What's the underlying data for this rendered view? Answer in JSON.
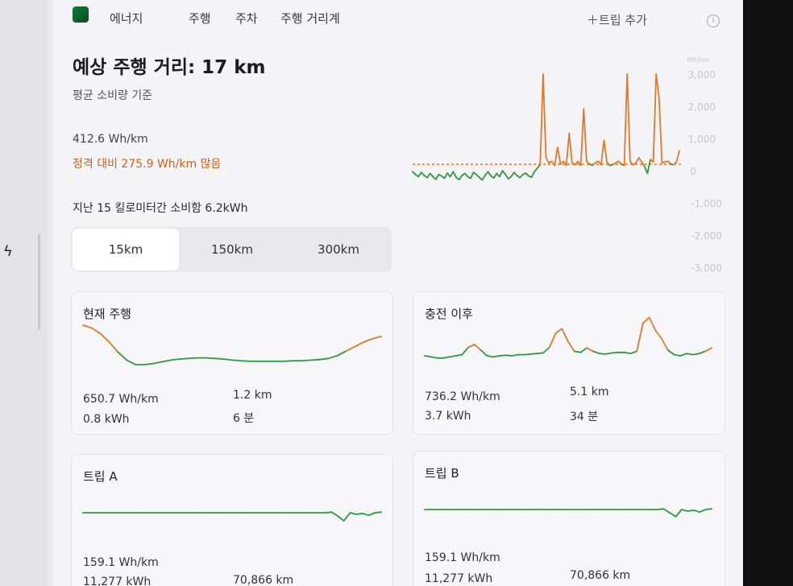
{
  "nav": {
    "tabs": [
      "에너지",
      "주행",
      "주차",
      "주행 거리계"
    ],
    "add_trip": "트립 추가",
    "add_icon": "plus-icon",
    "info_icon": "info-icon"
  },
  "summary": {
    "title": "예상 주행 거리: 17 km",
    "subtitle": "평균 소비량 기준",
    "avg_rate": "412.6 Wh/km",
    "vs_rated": "정격 대비 275.9 Wh/km 많음",
    "consumed": "지난 15 킬로미터간 소비함 6.2kWh"
  },
  "range_selector": {
    "options": [
      "15km",
      "150km",
      "300km"
    ],
    "selected": "15km"
  },
  "colors": {
    "above": "#e0782e",
    "below": "#2e9a3e",
    "warn_text": "#c9621a"
  },
  "chart_data": {
    "type": "line",
    "ylabel_unit": "Wh/km",
    "ylim": [
      -3000,
      3000
    ],
    "yticks": [
      "3,000",
      "2,000",
      "1,000",
      "0",
      "-1,000",
      "-2,000",
      "-3,000"
    ],
    "reference_line": 412.6,
    "series": [
      {
        "values": [
          200,
          120,
          60,
          180,
          90,
          30,
          150,
          60,
          -20,
          120,
          80,
          10,
          160,
          60,
          200,
          40,
          -30,
          90,
          150,
          60,
          10,
          180,
          120,
          40,
          -40,
          100,
          200,
          80,
          20,
          150,
          60,
          230,
          120,
          0,
          60,
          180,
          90,
          30,
          120,
          160,
          80,
          40,
          200,
          300,
          400,
          3000,
          600,
          450,
          500,
          380,
          900,
          420,
          500,
          380,
          1300,
          450,
          400,
          500,
          380,
          2000,
          500,
          420,
          380,
          450,
          500,
          400,
          1100,
          480,
          380,
          400,
          450,
          500,
          420,
          380,
          3000,
          500,
          400,
          450,
          600,
          480,
          350,
          150,
          550,
          480,
          3000,
          2300,
          450,
          480,
          500,
          420,
          400,
          480,
          800
        ]
      }
    ]
  },
  "cards": [
    {
      "title": "현재 주행",
      "rate": "650.7 Wh/km",
      "energy": "0.8 kWh",
      "distance": "1.2 km",
      "time": "6 분",
      "spark": [
        0.9,
        0.85,
        0.75,
        0.6,
        0.42,
        0.28,
        0.2,
        0.2,
        0.22,
        0.25,
        0.28,
        0.3,
        0.31,
        0.32,
        0.32,
        0.31,
        0.3,
        0.28,
        0.27,
        0.26,
        0.26,
        0.26,
        0.26,
        0.26,
        0.27,
        0.27,
        0.28,
        0.29,
        0.31,
        0.36,
        0.44,
        0.52,
        0.6,
        0.66,
        0.7
      ]
    },
    {
      "title": "충전 이후",
      "rate": "736.2 Wh/km",
      "energy": "3.7 kWh",
      "distance": "5.1 km",
      "time": "34 분",
      "spark": [
        0.3,
        0.28,
        0.26,
        0.26,
        0.28,
        0.3,
        0.32,
        0.45,
        0.5,
        0.4,
        0.3,
        0.28,
        0.3,
        0.31,
        0.3,
        0.32,
        0.32,
        0.33,
        0.34,
        0.35,
        0.45,
        0.7,
        0.78,
        0.55,
        0.38,
        0.36,
        0.44,
        0.38,
        0.34,
        0.33,
        0.35,
        0.36,
        0.36,
        0.34,
        0.38,
        0.88,
        0.98,
        0.75,
        0.6,
        0.4,
        0.32,
        0.3,
        0.34,
        0.32,
        0.34,
        0.38,
        0.44
      ]
    },
    {
      "title": "트립 A",
      "rate": "159.1 Wh/km",
      "energy": "11,277 kWh",
      "distance": "70,866 km",
      "time": "",
      "spark": [
        0.5,
        0.5,
        0.5,
        0.5,
        0.5,
        0.5,
        0.5,
        0.5,
        0.5,
        0.5,
        0.5,
        0.5,
        0.5,
        0.5,
        0.5,
        0.5,
        0.5,
        0.5,
        0.5,
        0.5,
        0.5,
        0.5,
        0.5,
        0.5,
        0.5,
        0.5,
        0.5,
        0.5,
        0.5,
        0.5,
        0.5,
        0.5,
        0.5,
        0.5,
        0.5,
        0.5,
        0.5,
        0.5,
        0.5,
        0.5,
        0.52,
        0.4,
        0.25,
        0.5,
        0.45,
        0.48,
        0.42,
        0.5,
        0.52
      ]
    },
    {
      "title": "트립 B",
      "rate": "159.1 Wh/km",
      "energy": "11,277 kWh",
      "distance": "70,866 km",
      "time": "",
      "spark": [
        0.5,
        0.5,
        0.5,
        0.5,
        0.5,
        0.5,
        0.5,
        0.5,
        0.5,
        0.5,
        0.5,
        0.5,
        0.5,
        0.5,
        0.5,
        0.5,
        0.5,
        0.5,
        0.5,
        0.5,
        0.5,
        0.5,
        0.5,
        0.5,
        0.5,
        0.5,
        0.5,
        0.5,
        0.5,
        0.5,
        0.5,
        0.5,
        0.5,
        0.5,
        0.5,
        0.5,
        0.5,
        0.5,
        0.5,
        0.5,
        0.52,
        0.4,
        0.28,
        0.5,
        0.45,
        0.48,
        0.42,
        0.5,
        0.52
      ]
    }
  ]
}
